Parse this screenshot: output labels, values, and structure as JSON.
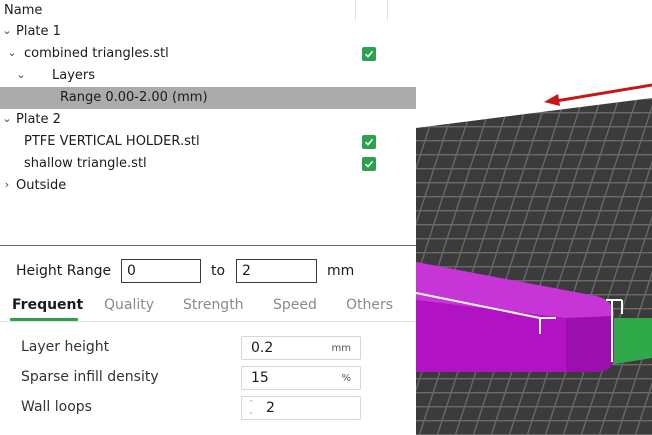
{
  "tree": {
    "header_name": "Name",
    "rows": [
      {
        "label": "Plate 1",
        "chevron": "expanded"
      },
      {
        "label": "combined triangles.stl",
        "chevron": "expanded",
        "checked": true
      },
      {
        "label": "Layers",
        "chevron": "expanded"
      },
      {
        "label": "Range 0.00-2.00 (mm)",
        "selected": true
      },
      {
        "label": "Plate 2",
        "chevron": "expanded"
      },
      {
        "label": "PTFE VERTICAL HOLDER.stl",
        "checked": true
      },
      {
        "label": "shallow triangle.stl",
        "checked": true
      },
      {
        "label": "Outside",
        "chevron": "collapsed"
      }
    ]
  },
  "height_range": {
    "label": "Height Range",
    "from": "0",
    "to_label": "to",
    "to": "2",
    "unit": "mm"
  },
  "tabs": [
    {
      "label": "Frequent",
      "active": true
    },
    {
      "label": "Quality"
    },
    {
      "label": "Strength"
    },
    {
      "label": "Speed"
    },
    {
      "label": "Others"
    }
  ],
  "settings": [
    {
      "label": "Layer height",
      "value": "0.2",
      "unit": "mm"
    },
    {
      "label": "Sparse infill density",
      "value": "15",
      "unit": "%"
    },
    {
      "label": "Wall loops",
      "value": "2",
      "unit": ""
    }
  ],
  "colors": {
    "accent": "#2aa14a",
    "selection": "#ababab",
    "model": "#b012c4",
    "plate": "#2ea848",
    "grid": "#3d3d3d"
  }
}
